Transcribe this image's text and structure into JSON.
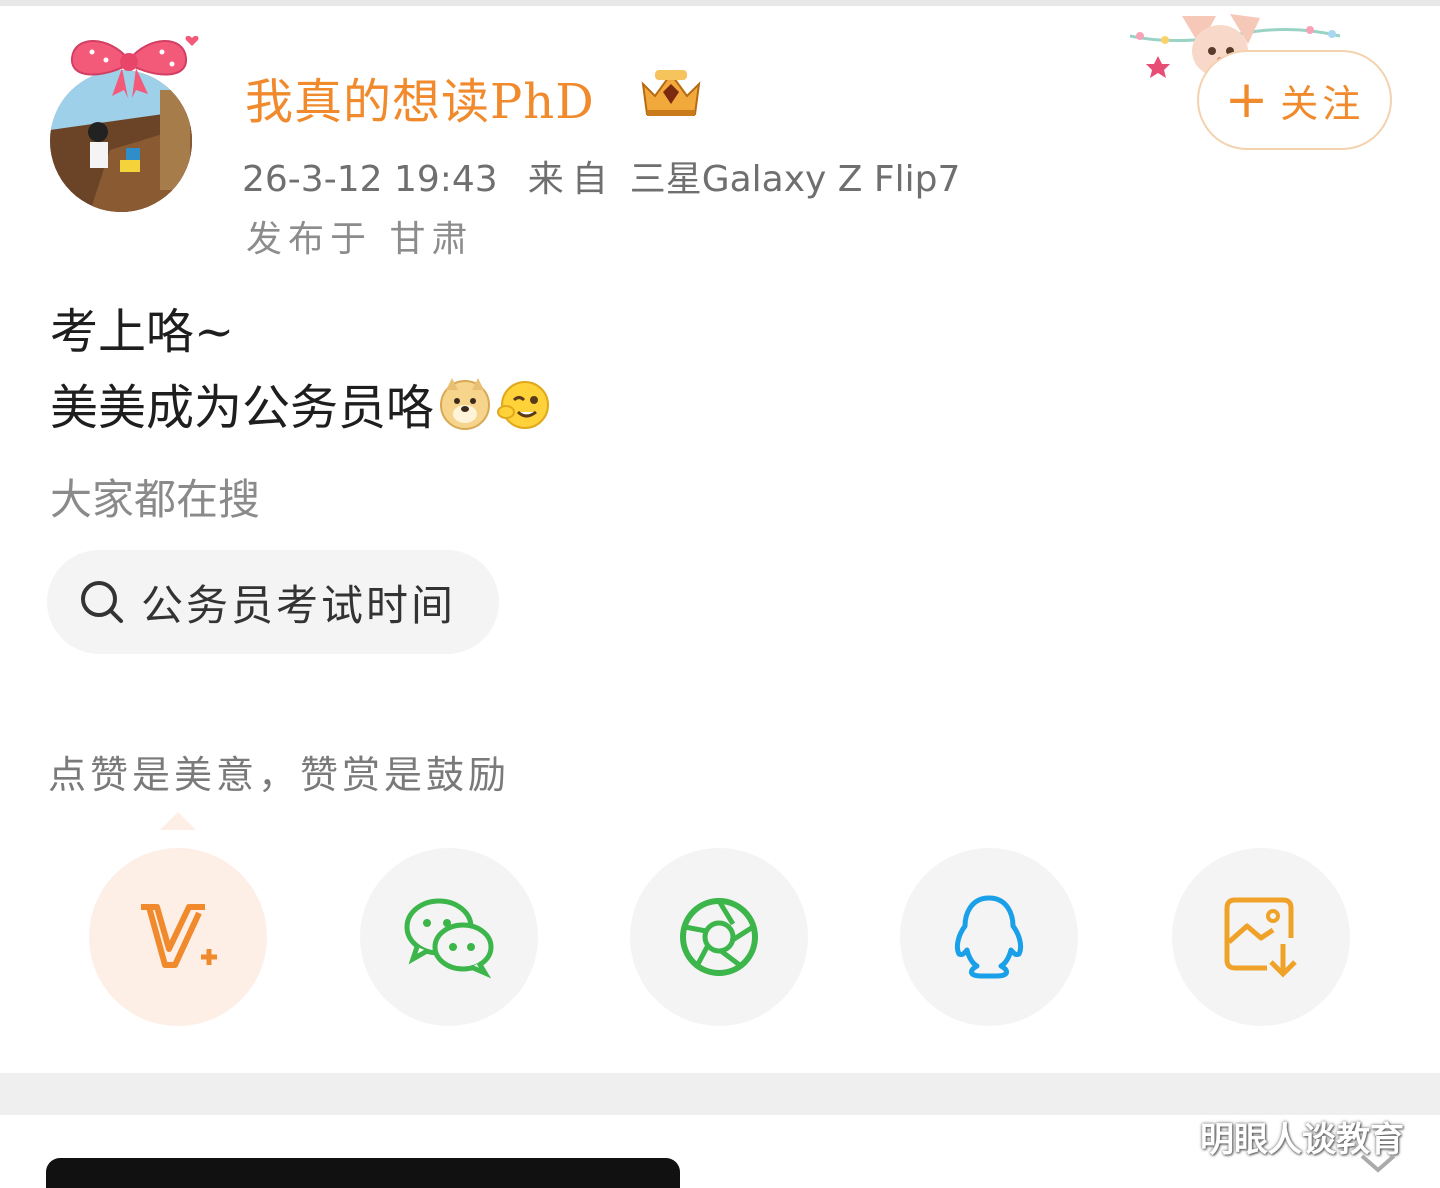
{
  "post": {
    "username": "我真的想读PhD",
    "time": "26-3-12 19:43",
    "from_label": "来自",
    "device": "三星Galaxy Z Flip7",
    "location": "发布于 甘肃",
    "follow_label": "关注",
    "line1": "考上咯~",
    "line2": "美美成为公务员咯"
  },
  "search": {
    "heading": "大家都在搜",
    "query": "公务员考试时间"
  },
  "reward": {
    "text": "点赞是美意，赞赏是鼓励"
  },
  "share": {
    "icons": [
      "v-plus-icon",
      "wechat-icon",
      "moments-icon",
      "qq-icon",
      "save-image-icon"
    ]
  },
  "watermark": "明眼人谈教育",
  "colors": {
    "accent": "#f08a2c",
    "wechat_green": "#3cb54a",
    "qq_blue": "#1aa0e8",
    "text": "#1e1e1e",
    "muted": "#8a8a8a"
  }
}
